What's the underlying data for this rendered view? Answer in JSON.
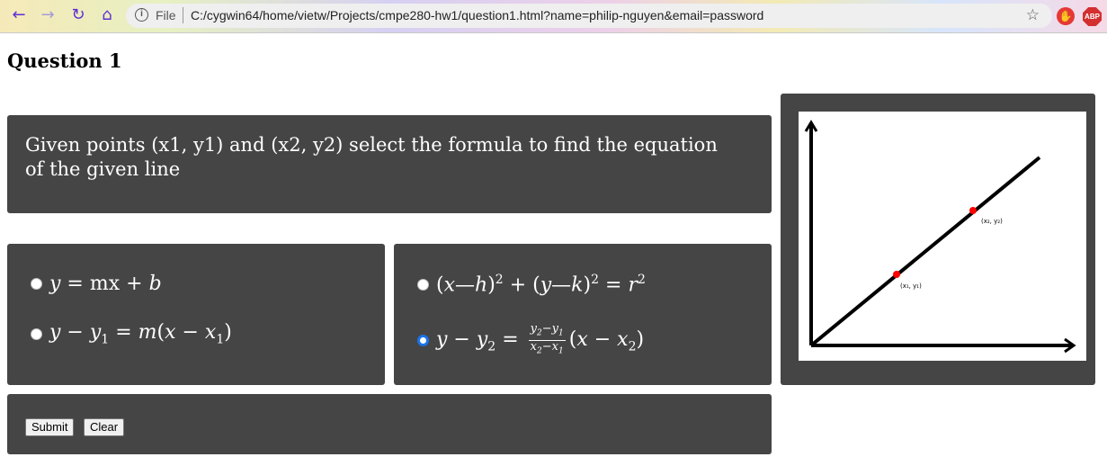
{
  "browser": {
    "url_prefix": "File",
    "url": "C:/cygwin64/home/vietw/Projects/cmpe280-hw1/question1.html?name=philip-nguyen&email=password",
    "extension_label": "ABP"
  },
  "page": {
    "title": "Question 1",
    "question": "Given points (x1, y1) and (x2, y2) select the formula to find the equation of the given line"
  },
  "options": {
    "selected": "opt4"
  },
  "diagram": {
    "point1_label": "(x₁, y₁)",
    "point2_label": "(x₂, y₂)"
  },
  "buttons": {
    "submit": "Submit",
    "clear": "Clear"
  },
  "colors": {
    "panel": "#454545",
    "point": "#ff0000",
    "radio_checked": "#1a73e8"
  }
}
